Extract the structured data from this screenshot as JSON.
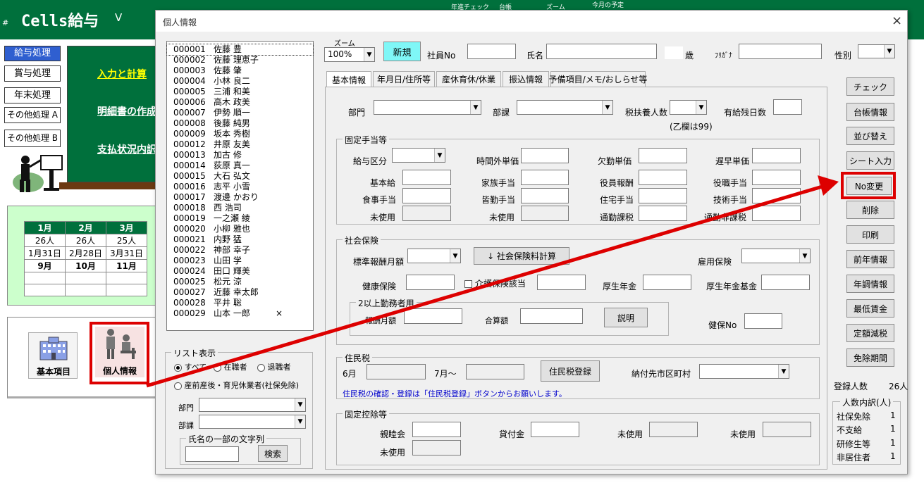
{
  "bg": {
    "title": "Cells給与",
    "title_v": "V",
    "top_menu": [
      "年進チェック",
      "台帳",
      "ズーム",
      "今月の予定"
    ],
    "side_buttons": [
      "給与処理",
      "賞与処理",
      "年末処理",
      "その他処理 A",
      "その他処理 B"
    ],
    "links": [
      "入力と計算",
      "明細書の作成",
      "支払状況内訳"
    ],
    "cal": {
      "months": [
        "1月",
        "2月",
        "3月"
      ],
      "counts": [
        "26人",
        "26人",
        "25人"
      ],
      "dates": [
        "1月31日",
        "2月28日",
        "3月31日"
      ],
      "months2": [
        "9月",
        "10月",
        "11月"
      ]
    },
    "icon_basic": "基本項目",
    "icon_personal": "個人情報"
  },
  "dialog": {
    "title": "個人情報",
    "close": "×",
    "employees": [
      {
        "no": "000001",
        "name": "佐藤 豊"
      },
      {
        "no": "000002",
        "name": "佐藤 理恵子"
      },
      {
        "no": "000003",
        "name": "佐藤 肇"
      },
      {
        "no": "000004",
        "name": "小林 良二"
      },
      {
        "no": "000005",
        "name": "三浦 和美"
      },
      {
        "no": "000006",
        "name": "高木 政美"
      },
      {
        "no": "000007",
        "name": "伊勢 順一"
      },
      {
        "no": "000008",
        "name": "後藤 純男"
      },
      {
        "no": "000009",
        "name": "坂本 秀樹"
      },
      {
        "no": "000012",
        "name": "井原 友美"
      },
      {
        "no": "000013",
        "name": "加古 修"
      },
      {
        "no": "000014",
        "name": "荻原 真一"
      },
      {
        "no": "000015",
        "name": "大石 弘文"
      },
      {
        "no": "000016",
        "name": "志平 小雪"
      },
      {
        "no": "000017",
        "name": "渡邊 かおり"
      },
      {
        "no": "000018",
        "name": "西 浩司"
      },
      {
        "no": "000019",
        "name": "一之瀬 綾"
      },
      {
        "no": "000020",
        "name": "小柳 雅也"
      },
      {
        "no": "000021",
        "name": "内野 猛"
      },
      {
        "no": "000022",
        "name": "神部 幸子"
      },
      {
        "no": "000023",
        "name": "山田 学"
      },
      {
        "no": "000024",
        "name": "田口 輝美"
      },
      {
        "no": "000025",
        "name": "松元 涼"
      },
      {
        "no": "000027",
        "name": "近藤 幸太郎"
      },
      {
        "no": "000028",
        "name": "平井 聡"
      },
      {
        "no": "000029",
        "name": "山本 一郎",
        "mark": "×"
      }
    ],
    "list_display": {
      "label": "リスト表示",
      "all": "すべて",
      "employed": "在職者",
      "retired": "退職者",
      "leave": "産前産後・育児休業者(社保免除)",
      "dept": "部門",
      "section": "部課",
      "name_part": "氏名の一部の文字列",
      "search": "検索"
    },
    "header": {
      "zoom_label": "ズーム",
      "zoom": "100%",
      "new": "新規",
      "emp_no": "社員No",
      "name": "氏名",
      "age": "歳",
      "kana": "ﾌﾘｶﾞﾅ",
      "gender": "性別"
    },
    "tabs": [
      "基本情報",
      "年月日/住所等",
      "産休育休/休業",
      "振込情報",
      "予備項目/メモ/おしらせ等"
    ],
    "basic": {
      "dept": "部門",
      "section": "部課",
      "dependents": "税扶養人数",
      "paid_leave": "有給残日数",
      "note": "(乙欄は99)",
      "fixed": {
        "title": "固定手当等",
        "kyuyo_kubun": "給与区分",
        "overtime": "時間外単価",
        "absence": "欠勤単価",
        "late": "遅早単価",
        "base": "基本給",
        "family": "家族手当",
        "officer": "役員報酬",
        "position": "役職手当",
        "meal": "食事手当",
        "attendance": "皆勤手当",
        "housing": "住宅手当",
        "skill": "技術手当",
        "unused1": "未使用",
        "unused2": "未使用",
        "commute_tax": "通勤課税",
        "commute_free": "通勤非課税"
      },
      "social": {
        "title": "社会保険",
        "std_monthly": "標準報酬月額",
        "calc_btn": "↓ 社会保険料計算",
        "employment": "雇用保険",
        "health": "健康保険",
        "care": "介護保険該当",
        "pension": "厚生年金",
        "pension_fund": "厚生年金基金",
        "two": "2以上勤務者用",
        "reward_monthly": "報酬月額",
        "total": "合算額",
        "explain": "説明",
        "health_no": "健保No"
      },
      "resident": {
        "title": "住民税",
        "june": "6月",
        "july": "7月～",
        "register": "住民税登録",
        "city": "納付先市区町村",
        "note": "住民税の確認・登録は「住民税登録」ボタンからお願いします。"
      },
      "deduct": {
        "title": "固定控除等",
        "mutual": "親睦会",
        "loan": "貸付金",
        "unused_a": "未使用",
        "unused_b": "未使用",
        "unused_c": "未使用"
      }
    },
    "right_buttons": [
      "チェック",
      "台帳情報",
      "並び替え",
      "シート入力",
      "No変更",
      "削除",
      "印刷",
      "前年情報",
      "年調情報",
      "最低賃金",
      "定額減税",
      "免除期間"
    ],
    "count_label": "登録人数",
    "count": "26人",
    "breakdown": {
      "title": "人数内訳(人)",
      "rows": [
        {
          "label": "社保免除",
          "value": "1"
        },
        {
          "label": "不支給",
          "value": "1"
        },
        {
          "label": "研修生等",
          "value": "1"
        },
        {
          "label": "非居住者",
          "value": "1"
        }
      ]
    }
  },
  "colors": {
    "green": "#00703c",
    "highlight_red": "#dd0000",
    "new_btn": "#7ff7f7"
  }
}
